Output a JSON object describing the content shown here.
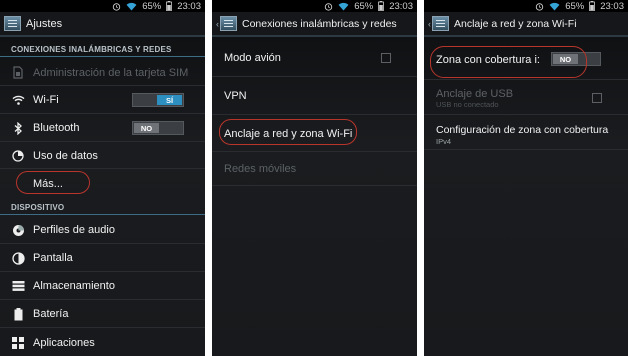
{
  "status": {
    "battery": "65%",
    "time": "23:03"
  },
  "screen1": {
    "title": "Ajustes",
    "section_wireless": "CONEXIONES INALÁMBRICAS Y REDES",
    "item_sim": "Administración de la tarjeta SIM",
    "item_wifi": "Wi-Fi",
    "wifi_toggle": "SÍ",
    "item_bluetooth": "Bluetooth",
    "bluetooth_toggle": "NO",
    "item_data": "Uso de datos",
    "item_more": "Más...",
    "section_device": "DISPOSITIVO",
    "item_audio": "Perfiles de audio",
    "item_screen": "Pantalla",
    "item_storage": "Almacenamiento",
    "item_battery": "Batería",
    "item_apps": "Aplicaciones"
  },
  "screen2": {
    "title": "Conexiones inalámbricas y redes",
    "item_airplane": "Modo avión",
    "item_vpn": "VPN",
    "item_tethering": "Anclaje a red y zona Wi-Fi",
    "item_mobile": "Redes móviles"
  },
  "screen3": {
    "title": "Anclaje a red y zona Wi-Fi",
    "item_hotspot": "Zona con cobertura i:",
    "hotspot_toggle": "NO",
    "item_usb": "Anclaje de USB",
    "usb_sub": "USB no conectado",
    "item_config": "Configuración de zona con cobertura",
    "config_sub": "IPv4"
  },
  "colors": {
    "accent": "#2c8fbf",
    "highlight": "#b8352c",
    "divider": "#3d6d86"
  },
  "icons": [
    "wifi-icon",
    "battery-icon",
    "alarm-icon",
    "sim-icon",
    "bluetooth-icon",
    "data-usage-icon",
    "audio-icon",
    "brightness-icon",
    "storage-icon",
    "battery-item-icon",
    "apps-icon",
    "settings-app-icon"
  ]
}
